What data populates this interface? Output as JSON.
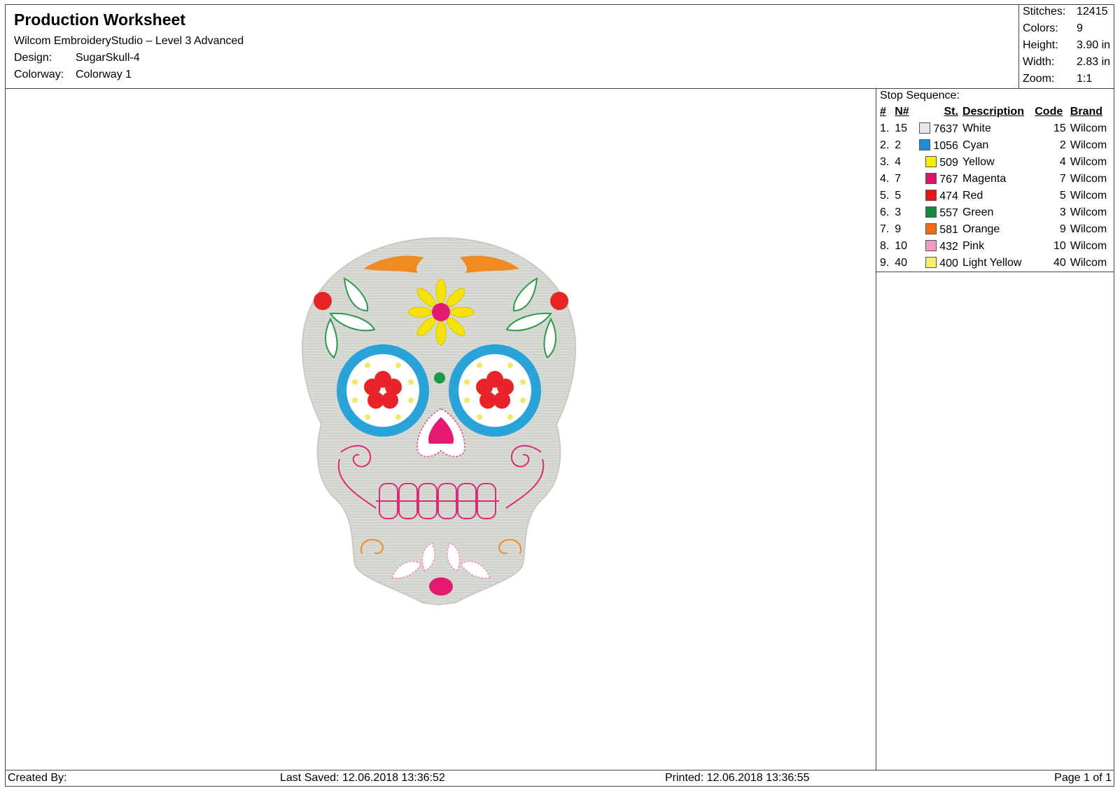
{
  "header": {
    "title": "Production Worksheet",
    "software": "Wilcom EmbroideryStudio – Level 3 Advanced",
    "design_label": "Design:",
    "design_value": "SugarSkull-4",
    "colorway_label": "Colorway:",
    "colorway_value": "Colorway 1"
  },
  "stats": {
    "stitches_label": "Stitches:",
    "stitches_value": "12415",
    "colors_label": "Colors:",
    "colors_value": "9",
    "height_label": "Height:",
    "height_value": "3.90 in",
    "width_label": "Width:",
    "width_value": "2.83 in",
    "zoom_label": "Zoom:",
    "zoom_value": "1:1"
  },
  "stop_sequence": {
    "title": "Stop Sequence:",
    "columns": [
      "#",
      "N#",
      "St.",
      "Description",
      "Code",
      "Brand"
    ],
    "rows": [
      {
        "num": "1.",
        "n": "15",
        "color": "#e6e6e6",
        "st": "7637",
        "desc": "White",
        "code": "15",
        "brand": "Wilcom"
      },
      {
        "num": "2.",
        "n": "2",
        "color": "#1e8fd6",
        "st": "1056",
        "desc": "Cyan",
        "code": "2",
        "brand": "Wilcom"
      },
      {
        "num": "3.",
        "n": "4",
        "color": "#f7ee00",
        "st": "509",
        "desc": "Yellow",
        "code": "4",
        "brand": "Wilcom"
      },
      {
        "num": "4.",
        "n": "7",
        "color": "#e0106a",
        "st": "767",
        "desc": "Magenta",
        "code": "7",
        "brand": "Wilcom"
      },
      {
        "num": "5.",
        "n": "5",
        "color": "#e8141a",
        "st": "474",
        "desc": "Red",
        "code": "5",
        "brand": "Wilcom"
      },
      {
        "num": "6.",
        "n": "3",
        "color": "#148a3c",
        "st": "557",
        "desc": "Green",
        "code": "3",
        "brand": "Wilcom"
      },
      {
        "num": "7.",
        "n": "9",
        "color": "#f26a10",
        "st": "581",
        "desc": "Orange",
        "code": "9",
        "brand": "Wilcom"
      },
      {
        "num": "8.",
        "n": "10",
        "color": "#f39ac6",
        "st": "432",
        "desc": "Pink",
        "code": "10",
        "brand": "Wilcom"
      },
      {
        "num": "9.",
        "n": "40",
        "color": "#f5ef6a",
        "st": "400",
        "desc": "Light Yellow",
        "code": "40",
        "brand": "Wilcom"
      }
    ]
  },
  "footer": {
    "created_by": "Created By:",
    "last_saved": "Last Saved: 12.06.2018 13:36:52",
    "printed": "Printed: 12.06.2018 13:36:55",
    "page": "Page 1 of 1"
  }
}
